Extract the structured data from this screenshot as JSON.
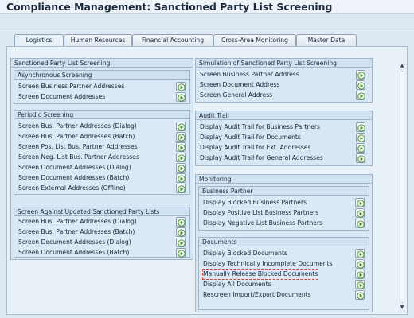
{
  "window": {
    "title": "Compliance Management: Sanctioned Party List Screening"
  },
  "tabs": [
    {
      "label": "Logistics",
      "active": true
    },
    {
      "label": "Human Resources",
      "active": false
    },
    {
      "label": "Financial Accounting",
      "active": false
    },
    {
      "label": "Cross-Area Monitoring",
      "active": false
    },
    {
      "label": "Master Data",
      "active": false
    }
  ],
  "left": {
    "main": {
      "title": "Sanctioned Party List Screening",
      "async": {
        "title": "Asynchronous Screening",
        "items": [
          "Screen Business Partner Addresses",
          "Screen Document Addresses"
        ]
      },
      "periodic": {
        "title": "Periodic Screening",
        "items": [
          "Screen Bus. Partner Addresses (Dialog)",
          "Screen Bus. Partner Addresses (Batch)",
          "Screen Pos. List Bus. Partner Addresses",
          "Screen Neg. List Bus. Partner Addresses",
          "Screen Document Addresses (Dialog)",
          "Screen Document Addresses (Batch)",
          "Screen External Addresses (Offline)"
        ]
      },
      "updated": {
        "title": "Screen Against Updated Sanctioned Party Lists",
        "items": [
          "Screen Bus. Partner Addresses (Dialog)",
          "Screen Bus. Partner Addresses (Batch)",
          "Screen Document Addresses (Dialog)",
          "Screen Document Addresses (Batch)"
        ]
      }
    }
  },
  "right": {
    "simulation": {
      "title": "Simulation of Sanctioned Party List Screening",
      "items": [
        "Screen Business Partner Address",
        "Screen Document Address",
        "Screen General Address"
      ]
    },
    "audit": {
      "title": "Audit Trail",
      "items": [
        "Display Audit Trail for Business Partners",
        "Display Audit Trail for Documents",
        "Display Audit Trail for Ext. Addresses",
        "Display Audit Trail for General Addresses"
      ]
    },
    "monitoring": {
      "title": "Monitoring",
      "bp": {
        "title": "Business Partner",
        "items": [
          "Display Blocked Business Partners",
          "Display Positive List Business Partners",
          "Display Negative List Business Partners"
        ]
      },
      "docs": {
        "title": "Documents",
        "items": [
          "Display Blocked Documents",
          "Display Technically Incomplete Documents",
          "Manually Release Blocked Documents",
          "Display All Documents",
          "Rescreen Import/Export Documents"
        ]
      }
    }
  },
  "icons": {
    "execute": "execute-icon"
  },
  "colors": {
    "accent": "#3f8b2f",
    "focus": "#d0453a"
  }
}
